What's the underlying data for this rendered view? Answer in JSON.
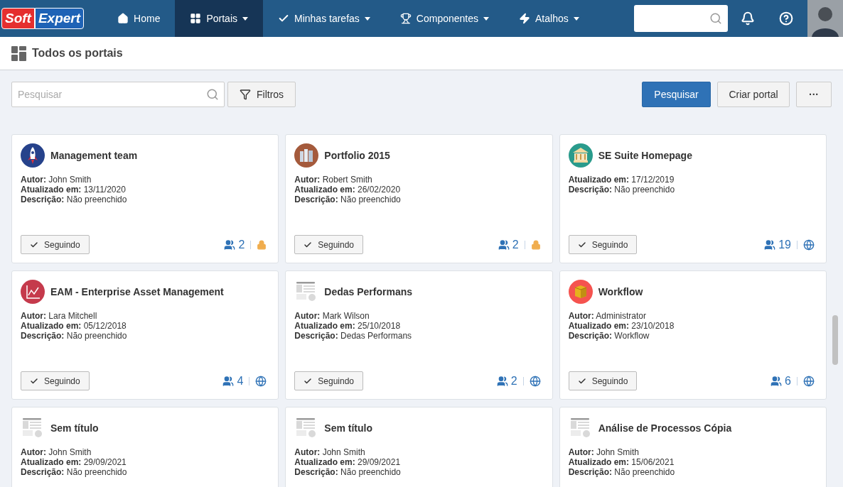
{
  "navbar": {
    "logo": {
      "part_1": "Soft",
      "part_2": "Expert"
    },
    "items": [
      {
        "label": "Home",
        "kind": "home",
        "has_menu": false,
        "selected": false
      },
      {
        "label": "Portais",
        "kind": "grid",
        "has_menu": true,
        "selected": true
      },
      {
        "label": "Minhas tarefas",
        "kind": "check",
        "has_menu": true,
        "selected": false
      },
      {
        "label": "Componentes",
        "kind": "trophy",
        "has_menu": true,
        "selected": false
      },
      {
        "label": "Atalhos",
        "kind": "bolt",
        "has_menu": true,
        "selected": false
      }
    ]
  },
  "page_title": "Todos os portais",
  "toolbar": {
    "search": {
      "placeholder": "Pesquisar"
    },
    "filter_button": "Filtros",
    "search_button": "Pesquisar",
    "create_button": "Criar portal",
    "more_button": "···"
  },
  "cards": [
    {
      "kind": "rocket",
      "title": "Management team",
      "lines": [
        "**Autor:** John Smith",
        "**Atualizado em:** 13/11/2020",
        "**Descrição:** Não preenchido"
      ],
      "follow_label": "Seguindo",
      "members": "2",
      "locked": true
    },
    {
      "kind": "building",
      "title": "Portfolio 2015",
      "lines": [
        "**Autor:** Robert Smith",
        "**Atualizado em:** 26/02/2020",
        "**Descrição:** Não preenchido"
      ],
      "follow_label": "Seguindo",
      "members": "2",
      "locked": true
    },
    {
      "kind": "bank",
      "title": "SE Suite Homepage",
      "lines": [
        "**Atualizado em:** 17/12/2019",
        "**Descrição:** Não preenchido"
      ],
      "follow_label": "Seguindo",
      "members": "19",
      "locked": false
    },
    {
      "kind": "chart",
      "title": "EAM - Enterprise Asset Management",
      "lines": [
        "**Autor:** Lara Mitchell",
        "**Atualizado em:** 05/12/2018",
        "**Descrição:** Não preenchido"
      ],
      "follow_label": "Seguindo",
      "members": "4",
      "locked": false
    },
    {
      "kind": "placeholder",
      "title": "Dedas Performans",
      "lines": [
        "**Autor:** Mark Wilson",
        "**Atualizado em:** 25/10/2018",
        "**Descrição:** Dedas Performans"
      ],
      "follow_label": "Seguindo",
      "members": "2",
      "locked": false
    },
    {
      "kind": "box",
      "title": "Workflow",
      "lines": [
        "**Autor:** Administrator",
        "**Atualizado em:** 23/10/2018",
        "**Descrição:** Workflow"
      ],
      "follow_label": "Seguindo",
      "members": "6",
      "locked": false
    },
    {
      "kind": "placeholder",
      "title": "Sem título",
      "lines": [
        "**Autor:** John Smith",
        "**Atualizado em:** 29/09/2021",
        "**Descrição:** Não preenchido"
      ]
    },
    {
      "kind": "placeholder",
      "title": "Sem título",
      "lines": [
        "**Autor:** John Smith",
        "**Atualizado em:** 29/09/2021",
        "**Descrição:** Não preenchido"
      ]
    },
    {
      "kind": "placeholder",
      "title": "Análise de Processos Cópia",
      "lines": [
        "**Autor:** John Smith",
        "**Atualizado em:** 15/06/2021",
        "**Descrição:** Não preenchido"
      ]
    }
  ]
}
